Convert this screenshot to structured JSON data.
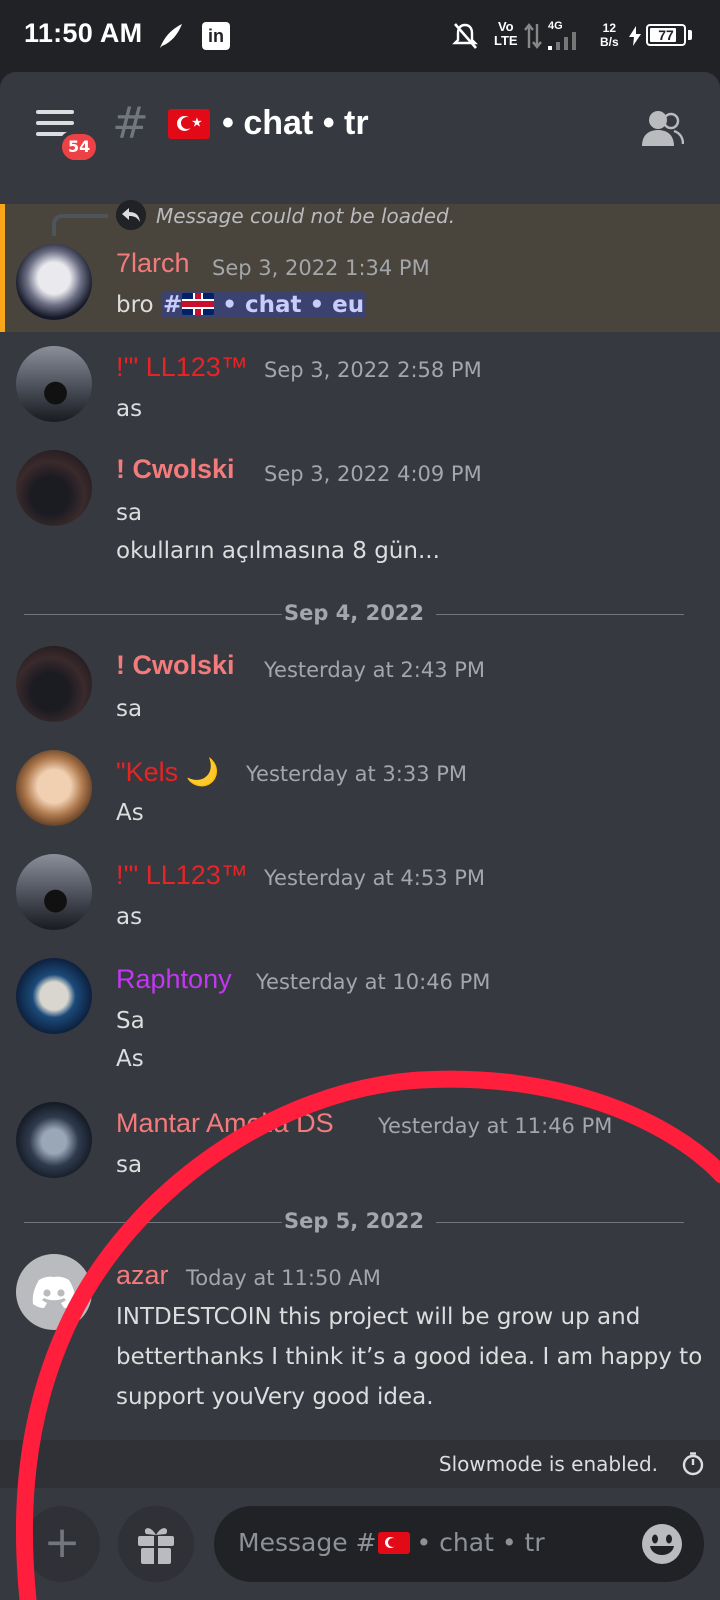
{
  "status_bar": {
    "time": "11:50 AM",
    "network_label": "Vo\nLTE",
    "network_type": "4G",
    "speed_value": "12",
    "speed_unit": "B/s",
    "battery": "77"
  },
  "header": {
    "channel_name": "• chat • tr",
    "unread_badge": "54",
    "menu_icon": "hamburger-icon",
    "members_icon": "members-icon"
  },
  "reply": {
    "text": "Message could not be loaded."
  },
  "messages": [
    {
      "user": "7larch",
      "time": "Sep 3, 2022 1:34 PM",
      "lines": [
        "bro"
      ],
      "mention": "• chat • eu",
      "color": "#f47b7b"
    },
    {
      "user": "!'\" LL123™",
      "time": "Sep 3, 2022 2:58 PM",
      "lines": [
        "as"
      ],
      "color": "#e82323"
    },
    {
      "user": "! Cwolski",
      "time": "Sep 3, 2022 4:09 PM",
      "lines": [
        "sa",
        "okulların açılmasına 8 gün..."
      ],
      "color": "#f47b7b"
    },
    {
      "user": "! Cwolski",
      "time": "Yesterday at 2:43 PM",
      "lines": [
        "sa"
      ],
      "color": "#f47b7b"
    },
    {
      "user": "\"Kels 🌙",
      "time": "Yesterday at 3:33 PM",
      "lines": [
        "As"
      ],
      "color": "#e82323"
    },
    {
      "user": "!'\" LL123™",
      "time": "Yesterday at 4:53 PM",
      "lines": [
        "as"
      ],
      "color": "#e82323"
    },
    {
      "user": "Raphtony",
      "time": "Yesterday at 10:46 PM",
      "lines": [
        "Sa",
        "As"
      ],
      "color": "#c337f2"
    },
    {
      "user": "Mantar Amelia DS",
      "time": "Yesterday at 11:46 PM",
      "lines": [
        "sa"
      ],
      "color": "#f47b7b"
    },
    {
      "user": "azar",
      "time": "Today at 11:50 AM",
      "lines": [
        "INTDESTCOIN  this project will be grow up and",
        "betterthanks I think it’s a good idea. I am happy to",
        "support youVery good idea."
      ],
      "color": "#f47b7b"
    }
  ],
  "dividers": [
    "Sep 4, 2022",
    "Sep 5, 2022"
  ],
  "slowmode": {
    "text": "Slowmode is enabled."
  },
  "composer": {
    "plus_label": "+",
    "placeholder_prefix": "Message #",
    "placeholder_channel": "• chat • tr"
  },
  "colors": {
    "accent_red": "#ed4245",
    "annotation_red": "#ff1f3d",
    "highlight_bar": "#faa61a"
  }
}
